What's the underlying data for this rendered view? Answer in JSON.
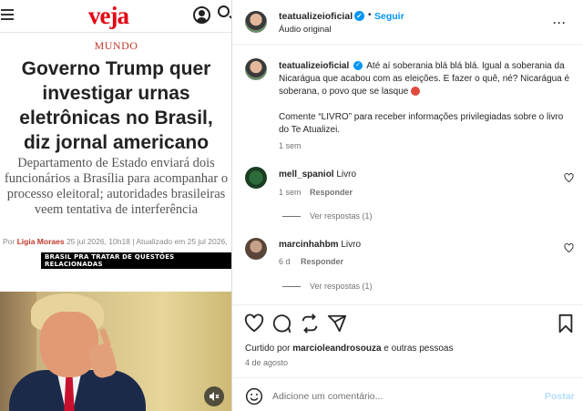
{
  "article": {
    "logo": "veja",
    "section": "MUNDO",
    "headline": "Governo Trump quer investigar urnas eletrônicas no Brasil, diz jornal americano",
    "dek": "Departamento de Estado enviará dois funcionários a Brasília para acompanhar o processo eleitoral; autoridades brasileiras veem tentativa de interferência",
    "byline_prefix": "Por",
    "author": "Ligia Moraes",
    "published": "25 jul 2026, 10h18 | Atualizado em 25 jul 2026,",
    "video_caption": "BRASIL PRA TRATAR DE QUESTÕES RELACIONADAS"
  },
  "post": {
    "username": "teatualizeioficial",
    "follow_label": "Seguir",
    "audio": "Áudio original",
    "more": "···",
    "caption_user": "teatualizeioficial",
    "caption_text": "Até aí soberania blá blá blá. Igual a soberania da Nicarágua que acabou com as eleições. E fazer o quê, né? Nicarágua é soberana, o povo que se lasque",
    "caption_cta": "Comente “LIVRO” para receber informações privilegiadas sobre o livro do Te Atualizei.",
    "caption_time": "1 sem"
  },
  "comments": [
    {
      "user": "mell_spaniol",
      "text": "Livro",
      "time": "1 sem",
      "reply": "Responder",
      "view_replies": "Ver respostas (1)"
    },
    {
      "user": "marcinhahbm",
      "text": "Livro",
      "time": "6 d",
      "reply": "Responder",
      "view_replies": "Ver respostas (1)"
    }
  ],
  "likes": {
    "prefix": "Curtido por",
    "user": "marcioleandrosouza",
    "suffix": "e outras pessoas"
  },
  "date": "4 de agosto",
  "composer": {
    "placeholder": "Adicione um comentário...",
    "post_label": "Postar"
  },
  "colors": {
    "accent": "#0095f6",
    "veja_red": "#e30613",
    "muted": "#737373"
  }
}
